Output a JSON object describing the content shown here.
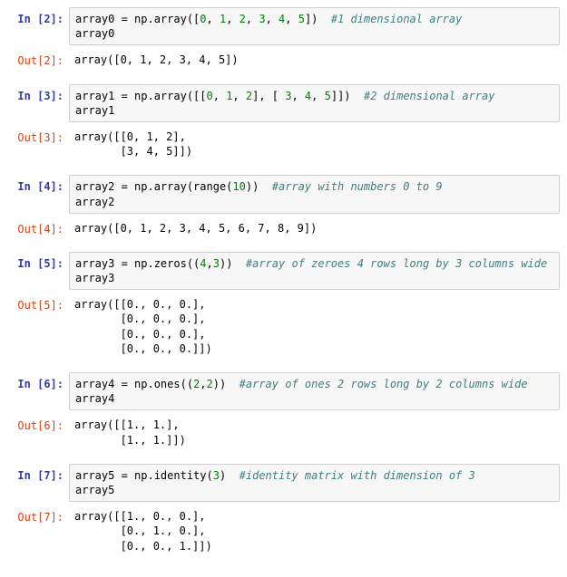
{
  "cells": [
    {
      "in_n": "2",
      "code": "array0 = np.array([0, 1, 2, 3, 4, 5])  #1 dimensional array\narray0",
      "out": "array([0, 1, 2, 3, 4, 5])"
    },
    {
      "in_n": "3",
      "code": "array1 = np.array([[0, 1, 2], [ 3, 4, 5]])  #2 dimensional array\narray1",
      "out": "array([[0, 1, 2],\n       [3, 4, 5]])"
    },
    {
      "in_n": "4",
      "code": "array2 = np.array(range(10))  #array with numbers 0 to 9\narray2",
      "out": "array([0, 1, 2, 3, 4, 5, 6, 7, 8, 9])"
    },
    {
      "in_n": "5",
      "code": "array3 = np.zeros((4,3))  #array of zeroes 4 rows long by 3 columns wide\narray3",
      "out": "array([[0., 0., 0.],\n       [0., 0., 0.],\n       [0., 0., 0.],\n       [0., 0., 0.]])"
    },
    {
      "in_n": "6",
      "code": "array4 = np.ones((2,2))  #array of ones 2 rows long by 2 columns wide\narray4",
      "out": "array([[1., 1.],\n       [1., 1.]])"
    },
    {
      "in_n": "7",
      "code": "array5 = np.identity(3)  #identity matrix with dimension of 3\narray5",
      "out": "array([[1., 0., 0.],\n       [0., 1., 0.],\n       [0., 0., 1.]])"
    }
  ],
  "prompt_in_prefix": "In [",
  "prompt_in_suffix": "]:",
  "prompt_out_prefix": "Out[",
  "prompt_out_suffix": "]:"
}
